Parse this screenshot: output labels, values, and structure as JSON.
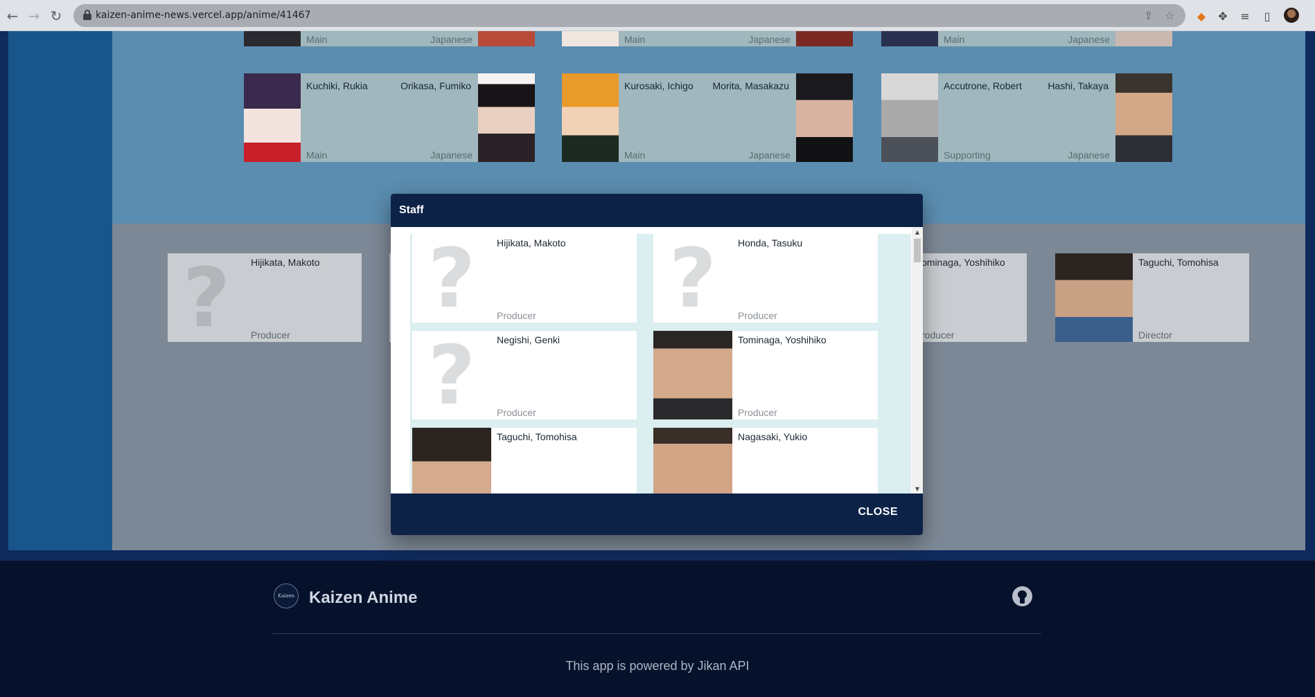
{
  "browser": {
    "url": "kaizen-anime-news.vercel.app/anime/41467"
  },
  "characters_partial": [
    {
      "role": "Main",
      "lang": "Japanese"
    },
    {
      "role": "Main",
      "lang": "Japanese"
    },
    {
      "role": "Main",
      "lang": "Japanese"
    }
  ],
  "characters": [
    {
      "name": "Kuchiki, Rukia",
      "voice_actor": "Orikasa, Fumiko",
      "role": "Main",
      "lang": "Japanese"
    },
    {
      "name": "Kurosaki, Ichigo",
      "voice_actor": "Morita, Masakazu",
      "role": "Main",
      "lang": "Japanese"
    },
    {
      "name": "Accutrone, Robert",
      "voice_actor": "Hashi, Takaya",
      "role": "Supporting",
      "lang": "Japanese"
    }
  ],
  "background_staff": [
    {
      "name": "Hijikata, Makoto",
      "role": "Producer"
    },
    {
      "name": "ominaga, Yoshihiko",
      "role": "roducer"
    },
    {
      "name": "Taguchi, Tomohisa",
      "role": "Director"
    }
  ],
  "modal": {
    "title": "Staff",
    "close_label": "CLOSE",
    "staff": [
      {
        "name": "Hijikata, Makoto",
        "role": "Producer"
      },
      {
        "name": "Honda, Tasuku",
        "role": "Producer"
      },
      {
        "name": "Negishi, Genki",
        "role": "Producer"
      },
      {
        "name": "Tominaga, Yoshihiko",
        "role": "Producer"
      },
      {
        "name": "Taguchi, Tomohisa",
        "role": ""
      },
      {
        "name": "Nagasaki, Yukio",
        "role": ""
      }
    ]
  },
  "footer": {
    "logo_text": "Kaizen",
    "brand": "Kaizen Anime",
    "powered_by": "This app is powered by Jikan API"
  }
}
